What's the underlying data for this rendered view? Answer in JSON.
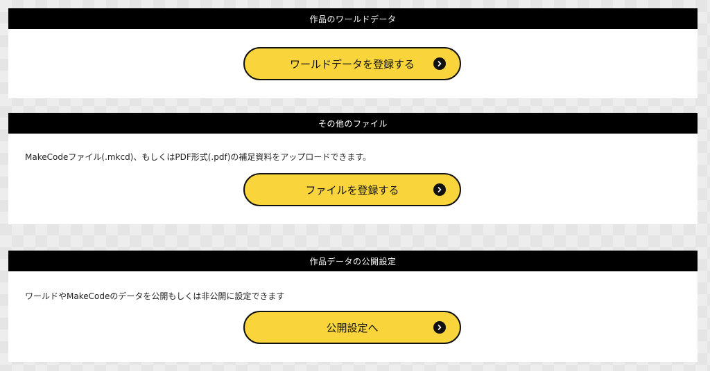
{
  "colors": {
    "header_bg": "#000000",
    "header_text": "#ffffff",
    "button_bg": "#f9d53b",
    "button_border": "#111111",
    "panel_bg": "#ffffff"
  },
  "sections": [
    {
      "header": "作品のワールドデータ",
      "description": "",
      "button_label": "ワールドデータを登録する",
      "button_icon": "chevron-right-circle-icon"
    },
    {
      "header": "その他のファイル",
      "description": "MakeCodeファイル(.mkcd)、もしくはPDF形式(.pdf)の補足資料をアップロードできます。",
      "button_label": "ファイルを登録する",
      "button_icon": "chevron-right-circle-icon"
    },
    {
      "header": "作品データの公開設定",
      "description": "ワールドやMakeCodeのデータを公開もしくは非公開に設定できます",
      "button_label": "公開設定へ",
      "button_icon": "chevron-right-circle-icon"
    }
  ]
}
